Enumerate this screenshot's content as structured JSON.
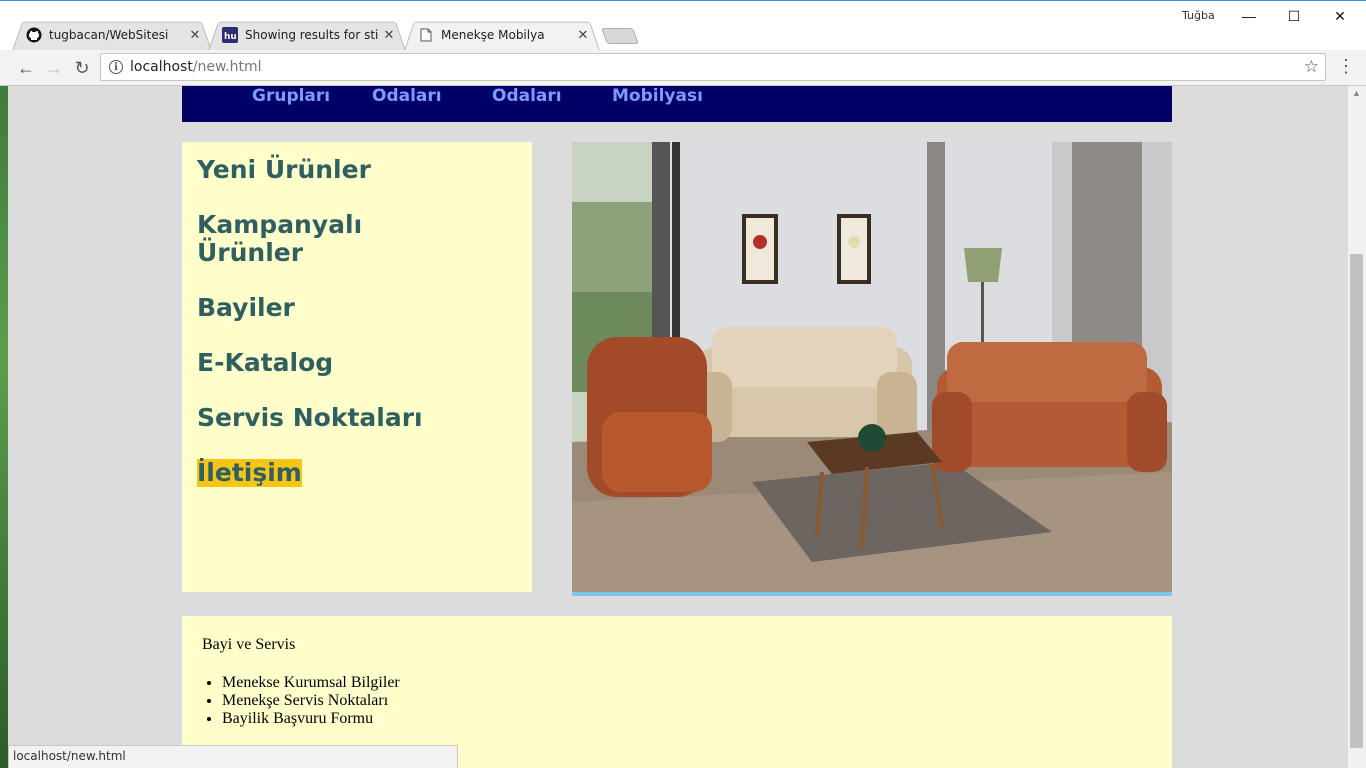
{
  "browser": {
    "user": "Tuğba",
    "tabs": [
      {
        "title": "tugbacan/WebSitesi",
        "icon": "github-icon"
      },
      {
        "title": "Showing results for stil.cs",
        "icon": "site-logo-icon"
      },
      {
        "title": "Menekşe Mobilya",
        "icon": "page-icon"
      }
    ],
    "address": {
      "host": "localhost",
      "path": "/new.html"
    },
    "status_url": "localhost/new.html"
  },
  "page": {
    "nav": [
      "Grupları",
      "Odaları",
      "Odaları",
      "Mobilyası"
    ],
    "sidebar": [
      "Yeni Ürünler",
      "Kampanyalı Ürünler",
      "Bayiler",
      "E-Katalog",
      "Servis Noktaları",
      "İletişim"
    ],
    "hero_alt": "living room sofa set",
    "footer": {
      "heading": "Bayi ve Servis",
      "links": [
        "Menekse Kurumsal Bilgiler",
        "Menekşe Servis Noktaları",
        "Bayilik Başvuru Formu"
      ]
    }
  },
  "colors": {
    "nav_bg": "#000066",
    "nav_text": "#7b9bff",
    "panel_bg": "#ffffcc",
    "sidebar_text": "#2f5f60",
    "highlight": "#f5c518"
  }
}
